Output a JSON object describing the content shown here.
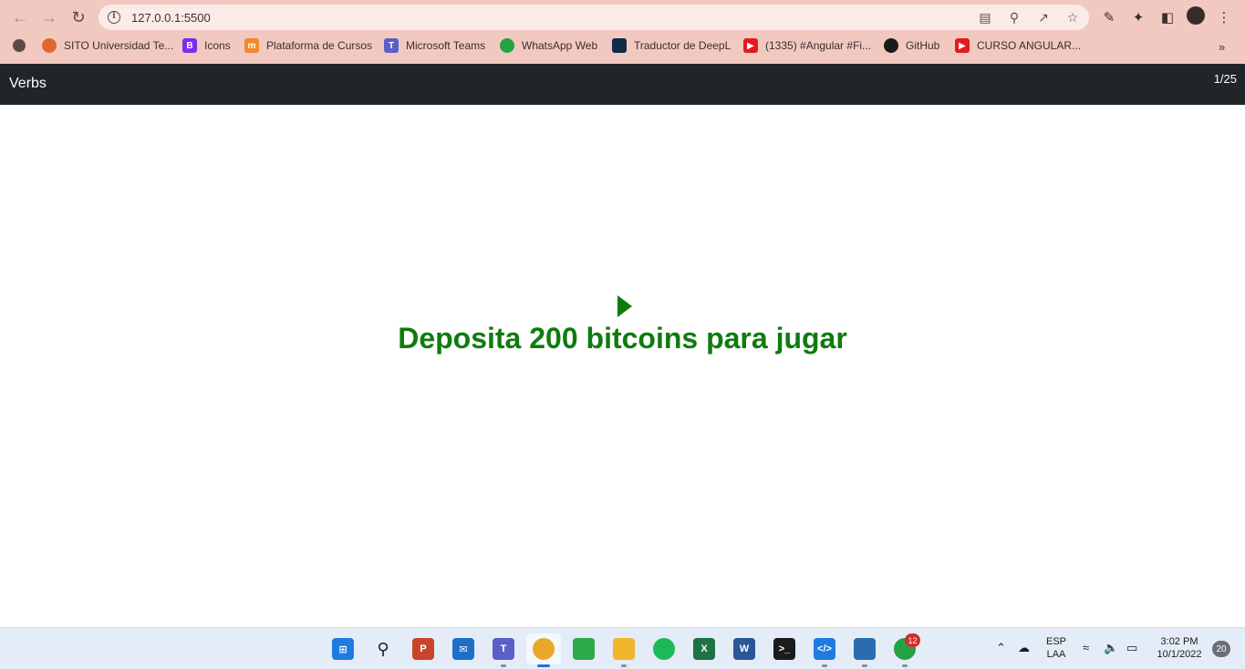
{
  "browser": {
    "url": "127.0.0.1:5500",
    "bookmarks": [
      {
        "label": "SITO Universidad Te...",
        "icon": "sito-icon",
        "color": "#e0662f"
      },
      {
        "label": "Icons",
        "icon": "bootstrap-icon",
        "color": "#7b2cf0"
      },
      {
        "label": "Plataforma de Cursos",
        "icon": "moodle-icon",
        "color": "#f0882c"
      },
      {
        "label": "Microsoft Teams",
        "icon": "teams-icon",
        "color": "#5b5fc7"
      },
      {
        "label": "WhatsApp Web",
        "icon": "whatsapp-icon",
        "color": "#25a244"
      },
      {
        "label": "Traductor de DeepL",
        "icon": "deepl-icon",
        "color": "#0f2b46"
      },
      {
        "label": "(1335) #Angular #Fi...",
        "icon": "youtube-icon",
        "color": "#e31b1b"
      },
      {
        "label": "GitHub",
        "icon": "github-icon",
        "color": "#1b1b1b"
      },
      {
        "label": "CURSO ANGULAR...",
        "icon": "youtube-icon",
        "color": "#e31b1b"
      }
    ]
  },
  "navbar": {
    "brand": "Verbs",
    "counter": "1/25"
  },
  "main": {
    "message": "Deposita 200 bitcoins para jugar",
    "accent_color": "#0f7b0f"
  },
  "taskbar": {
    "whatsapp_badge": "12",
    "lang_top": "ESP",
    "lang_bottom": "LAA",
    "time": "3:02 PM",
    "date": "10/1/2022",
    "notifications": "20"
  }
}
